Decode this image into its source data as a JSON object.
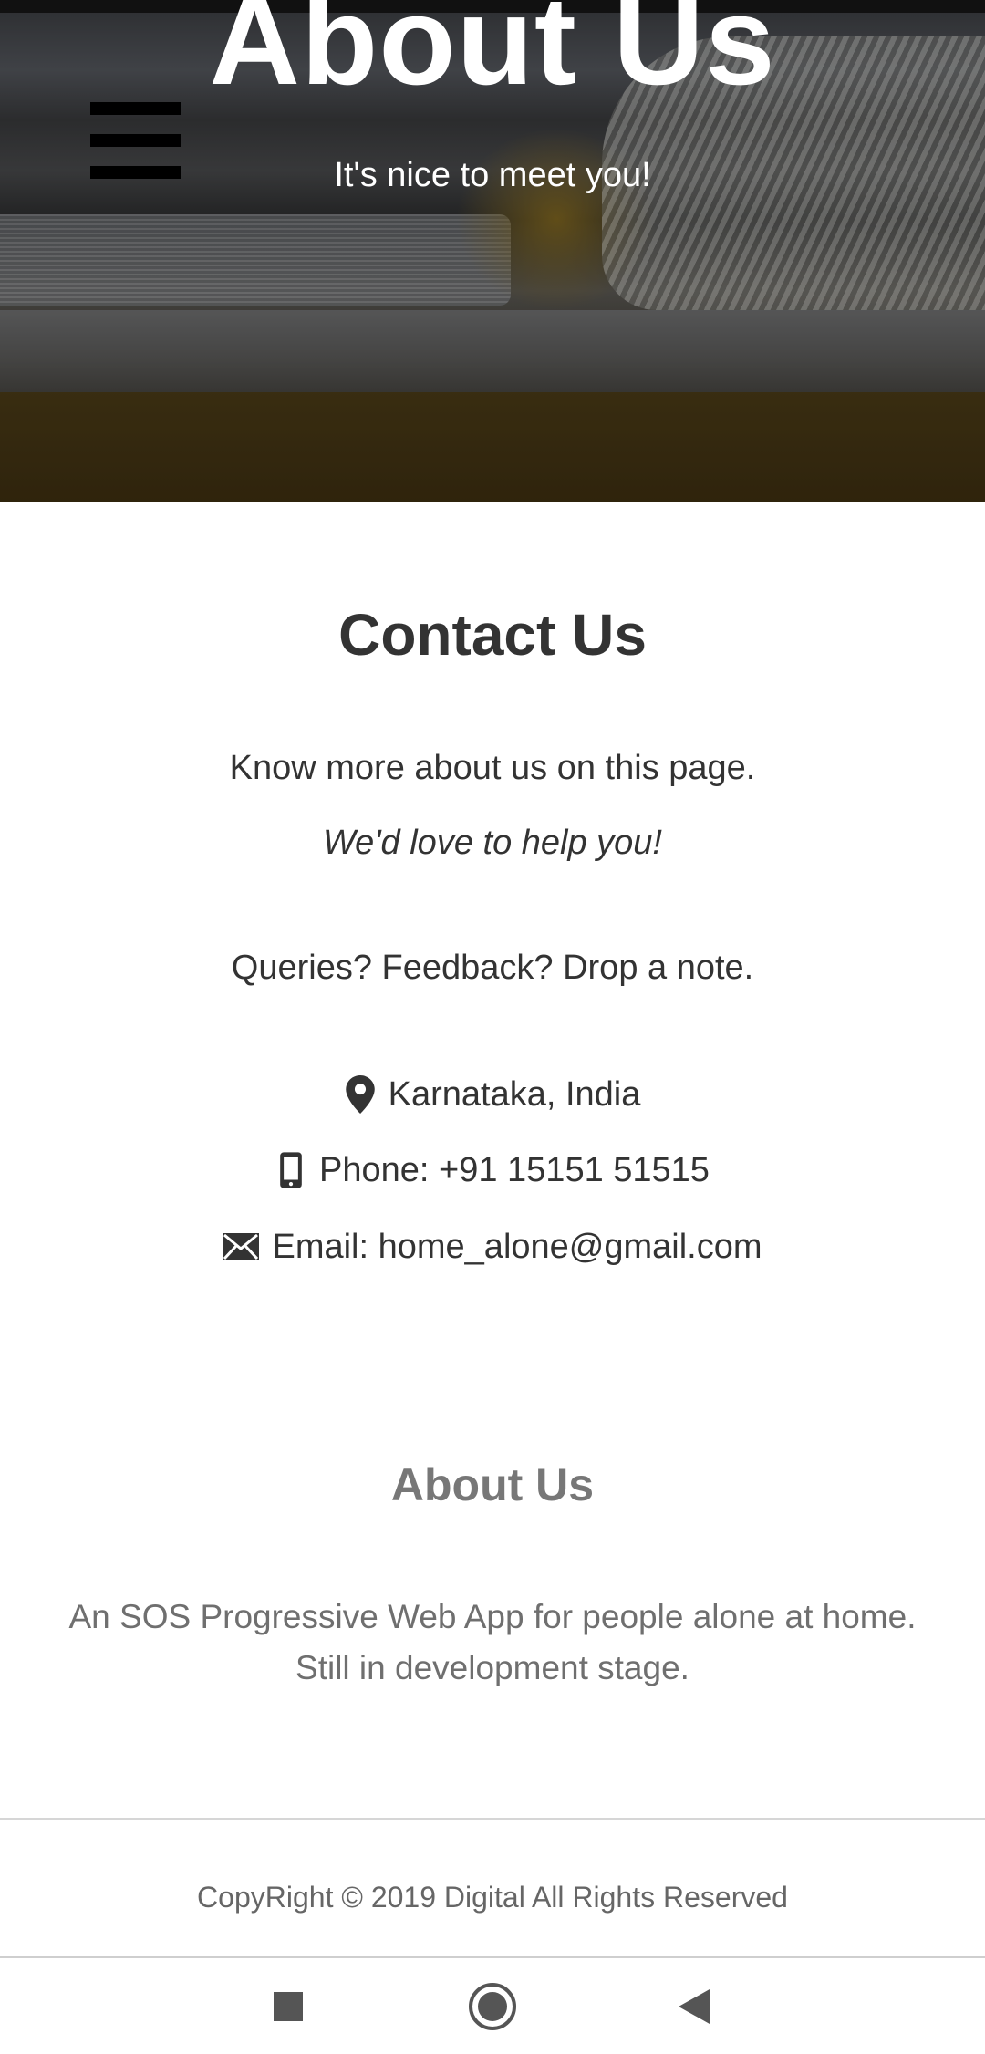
{
  "hero": {
    "title": "About Us",
    "subtitle": "It's nice to meet you!",
    "menu_icon": "hamburger-menu-icon"
  },
  "contact": {
    "title": "Contact Us",
    "intro": "Know more about us on this page.",
    "tagline": "We'd love to help you!",
    "queries": "Queries? Feedback? Drop a note.",
    "location": {
      "icon": "map-marker-icon",
      "text": "Karnataka, India"
    },
    "phone": {
      "icon": "mobile-phone-icon",
      "text": "Phone: +91 15151 51515"
    },
    "email": {
      "icon": "envelope-icon",
      "text": "Email: home_alone@gmail.com"
    }
  },
  "about": {
    "title": "About Us",
    "description_line1": "An SOS Progressive Web App for people alone at home.",
    "description_line2": "Still in development stage."
  },
  "footer": {
    "copyright": "CopyRight © 2019 Digital All Rights Reserved"
  },
  "nav_bar": {
    "recents_icon": "square-recents-icon",
    "home_icon": "circle-home-icon",
    "back_icon": "triangle-back-icon"
  },
  "colors": {
    "heading": "#333333",
    "about_heading": "#777777",
    "muted_text": "#6f6f6f",
    "hero_text": "#ffffff"
  }
}
